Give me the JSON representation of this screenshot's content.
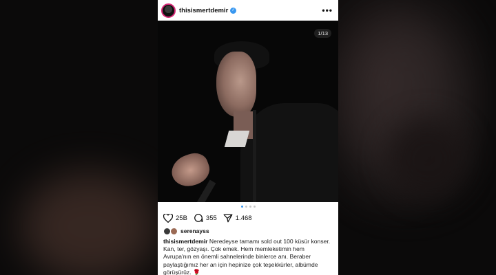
{
  "post": {
    "username": "thisismertdemir",
    "verified_mark": "✓",
    "more_glyph": "•••",
    "counter": "1/13",
    "carousel": {
      "dots": 4,
      "active_index": 0
    },
    "likes": "25B",
    "comments": "355",
    "shares": "1.468",
    "liked_by": "serenayss",
    "caption_user": "thisismertdemir",
    "caption_text": "Neredeyse tamamı sold out 100 küsür konser. Kan, ter, gözyaşı. Çok emek. Hem memleketimin hem Avrupa'nın en önemli sahnelerinde binlerce anı. Beraber paylaştığımız her an için hepinize çok teşekkürler, albümde görüşürüz.",
    "caption_emoji": "🌹"
  },
  "icons": {
    "avatar": "avatar",
    "verified": "verified-badge-icon",
    "more": "more-icon",
    "like": "heart-icon",
    "comment": "comment-icon",
    "share": "send-icon"
  },
  "colors": {
    "verified_blue": "#3897f0",
    "story_ring": "#d62976"
  }
}
